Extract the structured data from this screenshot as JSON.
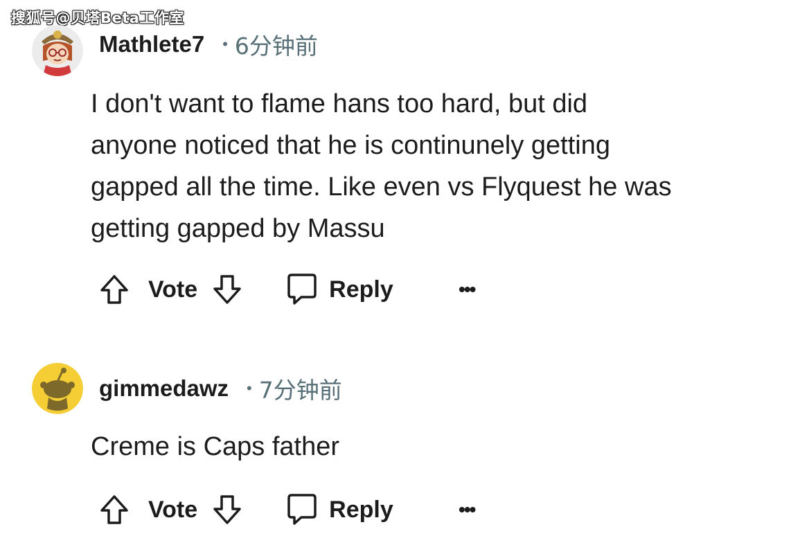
{
  "watermark": "搜狐号@贝塔Beta工作室",
  "comments": [
    {
      "username": "Mathlete7",
      "dot": "•",
      "time": "6分钟前",
      "lines": [
        "I don't want to flame hans too hard, but did",
        "anyone noticed that he is continunely getting",
        "gapped all the time. Like even vs Flyquest he was",
        "getting gapped by Massu"
      ],
      "vote_label": "Vote",
      "reply_label": "Reply",
      "more_label": "•••",
      "avatar_icon": "snoo-avatar-icon",
      "avatar_bg": "#f4e4c8"
    },
    {
      "username": "gimmedawz",
      "dot": "•",
      "time": "7分钟前",
      "lines": [
        "Creme is Caps father"
      ],
      "vote_label": "Vote",
      "reply_label": "Reply",
      "more_label": "•••",
      "avatar_icon": "default-snoo-icon",
      "avatar_bg": "#f5cd35"
    }
  ]
}
